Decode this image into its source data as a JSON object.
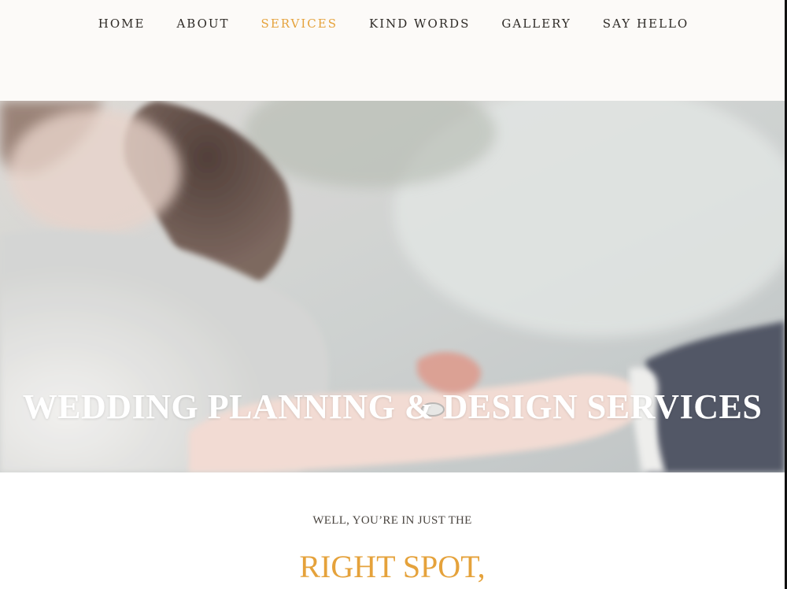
{
  "nav": {
    "items": [
      {
        "label": "HOME",
        "active": false
      },
      {
        "label": "ABOUT",
        "active": false
      },
      {
        "label": "SERVICES",
        "active": true
      },
      {
        "label": "KIND WORDS",
        "active": false
      },
      {
        "label": "GALLERY",
        "active": false
      },
      {
        "label": "SAY HELLO",
        "active": false
      }
    ]
  },
  "hero": {
    "title": "WEDDING PLANNING & DESIGN SERVICES"
  },
  "intro": {
    "kicker": "WELL, YOU’RE IN JUST THE",
    "headline": "RIGHT SPOT,"
  },
  "colors": {
    "accent": "#e5a23b",
    "nav_text": "#2e2a26",
    "header_bg": "#fcfaf8"
  }
}
